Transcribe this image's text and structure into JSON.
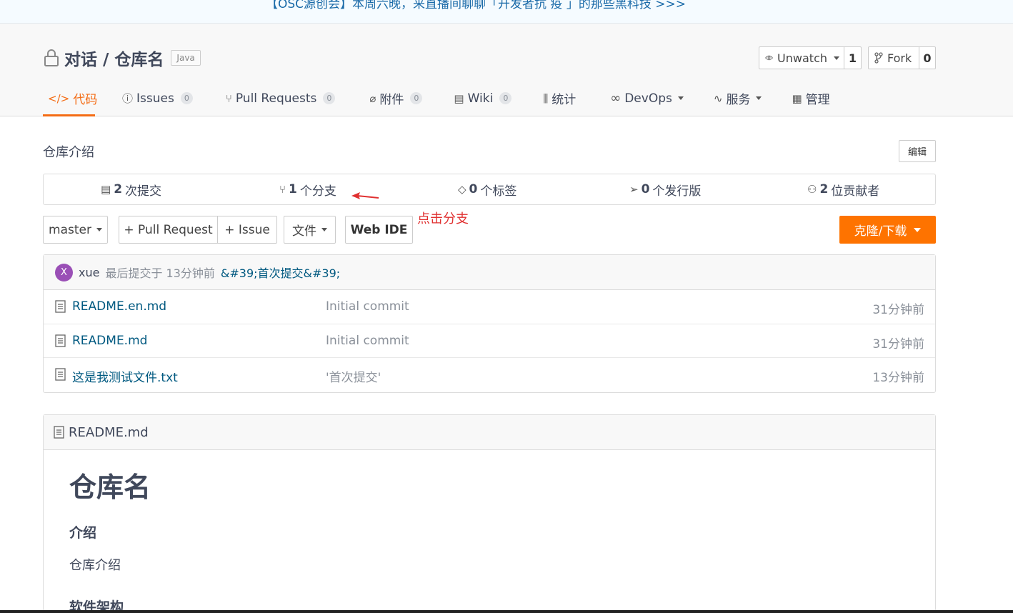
{
  "banner": {
    "text": "【OSC源创会】本周六晚，来直播间聊聊「开发者抗 疫 」的那些黑科技 >>>"
  },
  "repo": {
    "name": "对话 / 仓库名",
    "language": "Java"
  },
  "header_buttons": {
    "watch": {
      "label": "Unwatch",
      "count": "1"
    },
    "fork": {
      "label": "Fork",
      "count": "0"
    }
  },
  "tabs": [
    {
      "label": "代码",
      "badge": ""
    },
    {
      "label": "Issues",
      "badge": "0"
    },
    {
      "label": "Pull Requests",
      "badge": "0"
    },
    {
      "label": "附件",
      "badge": "0"
    },
    {
      "label": "Wiki",
      "badge": "0"
    },
    {
      "label": "统计",
      "badge": ""
    },
    {
      "label": "DevOps",
      "badge": ""
    },
    {
      "label": "服务",
      "badge": ""
    },
    {
      "label": "管理",
      "badge": ""
    }
  ],
  "intro": {
    "text": "仓库介绍",
    "edit_label": "编辑"
  },
  "stats": [
    {
      "count": "2",
      "label": "次提交"
    },
    {
      "count": "1",
      "label": "个分支"
    },
    {
      "count": "0",
      "label": "个标签"
    },
    {
      "count": "0",
      "label": "个发行版"
    },
    {
      "count": "2",
      "label": "位贡献者"
    }
  ],
  "annotation": {
    "text": "点击分支",
    "color": "#e03030"
  },
  "toolbar": {
    "branch": "master",
    "pull_request": "+ Pull Request",
    "issue": "+ Issue",
    "file": "文件",
    "web_ide": "Web IDE",
    "clone": "克隆/下载"
  },
  "last_commit": {
    "avatar": "X",
    "user": "xue",
    "text": "最后提交于 13分钟前",
    "message": "&#39;首次提交&#39;"
  },
  "files": [
    {
      "name": "README.en.md",
      "message": "Initial commit",
      "time": "31分钟前"
    },
    {
      "name": "README.md",
      "message": "Initial commit",
      "time": "31分钟前"
    },
    {
      "name": "这是我测试文件.txt",
      "message": "'首次提交'",
      "time": "13分钟前"
    }
  ],
  "readme": {
    "filename": "README.md",
    "h1": "仓库名",
    "h3_intro": "介绍",
    "intro_text": "仓库介绍",
    "h3_arch": "软件架构"
  },
  "colors": {
    "accent": "#f46c15",
    "clone_button": "#fe7300",
    "link": "#005980"
  }
}
